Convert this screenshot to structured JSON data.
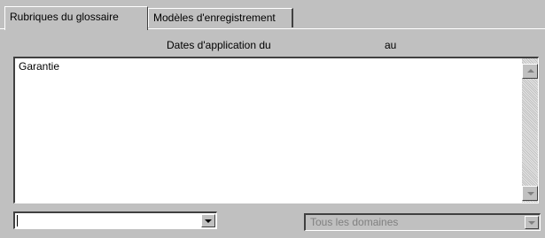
{
  "tabs": [
    {
      "label": "Rubriques du glossaire",
      "active": true
    },
    {
      "label": "Modèles d'enregistrement",
      "active": false
    }
  ],
  "columns": {
    "from_label": "Dates d'application du",
    "to_label": "au"
  },
  "list": {
    "items": [
      "Garantie"
    ]
  },
  "combos": {
    "left": {
      "value": ""
    },
    "right": {
      "value": "Tous les domaines",
      "disabled": true
    }
  },
  "icons": {
    "scroll_up": "scroll-up-arrow-icon",
    "scroll_down": "scroll-down-arrow-icon",
    "dropdown": "chevron-down-icon"
  },
  "colors": {
    "face": "#c0c0c0",
    "highlight": "#ffffff",
    "shadow": "#404040",
    "disabled_text": "#808080"
  }
}
